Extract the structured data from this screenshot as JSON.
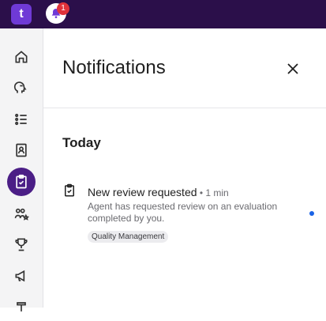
{
  "header": {
    "logo_text": "t",
    "notification_count": "1"
  },
  "sidebar": {
    "items": [
      {
        "icon": "home-icon",
        "active": false
      },
      {
        "icon": "speech-head-icon",
        "active": false
      },
      {
        "icon": "numbered-list-icon",
        "active": false
      },
      {
        "icon": "contacts-book-icon",
        "active": false
      },
      {
        "icon": "clipboard-check-icon",
        "active": true
      },
      {
        "icon": "people-star-icon",
        "active": false
      },
      {
        "icon": "trophy-icon",
        "active": false
      },
      {
        "icon": "megaphone-icon",
        "active": false
      },
      {
        "icon": "pin-icon",
        "active": false
      }
    ]
  },
  "panel": {
    "title": "Notifications",
    "section": "Today",
    "notifications": [
      {
        "title": "New review requested",
        "time": " • 1 min",
        "body": "Agent has requested review on an evaluation completed by you.",
        "tag": "Quality Management",
        "unread": true
      }
    ]
  },
  "colors": {
    "topbar": "#2b0f4a",
    "accent": "#4b1e86",
    "badge": "#e0323a",
    "unread_dot": "#1a63e6"
  }
}
